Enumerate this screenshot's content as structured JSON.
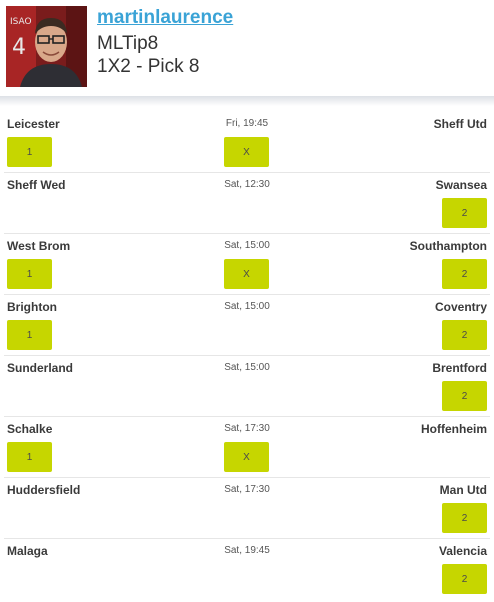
{
  "profile": {
    "username": "martinlaurence",
    "tip_name": "MLTip8",
    "tip_type": "1X2 - Pick 8",
    "avatar": "user-avatar-photo"
  },
  "colors": {
    "pick_bg": "#c6d600",
    "link": "#3aa3d6"
  },
  "matches": [
    {
      "home": "Leicester",
      "time": "Fri, 19:45",
      "away": "Sheff Utd",
      "picks": [
        "1",
        "X"
      ]
    },
    {
      "home": "Sheff Wed",
      "time": "Sat, 12:30",
      "away": "Swansea",
      "picks": [
        "2"
      ]
    },
    {
      "home": "West Brom",
      "time": "Sat, 15:00",
      "away": "Southampton",
      "picks": [
        "1",
        "X",
        "2"
      ]
    },
    {
      "home": "Brighton",
      "time": "Sat, 15:00",
      "away": "Coventry",
      "picks": [
        "1",
        "2"
      ]
    },
    {
      "home": "Sunderland",
      "time": "Sat, 15:00",
      "away": "Brentford",
      "picks": [
        "2"
      ]
    },
    {
      "home": "Schalke",
      "time": "Sat, 17:30",
      "away": "Hoffenheim",
      "picks": [
        "1",
        "X"
      ]
    },
    {
      "home": "Huddersfield",
      "time": "Sat, 17:30",
      "away": "Man Utd",
      "picks": [
        "2"
      ]
    },
    {
      "home": "Malaga",
      "time": "Sat, 19:45",
      "away": "Valencia",
      "picks": [
        "2"
      ]
    }
  ],
  "pick_labels": {
    "home": "1",
    "draw": "X",
    "away": "2"
  }
}
